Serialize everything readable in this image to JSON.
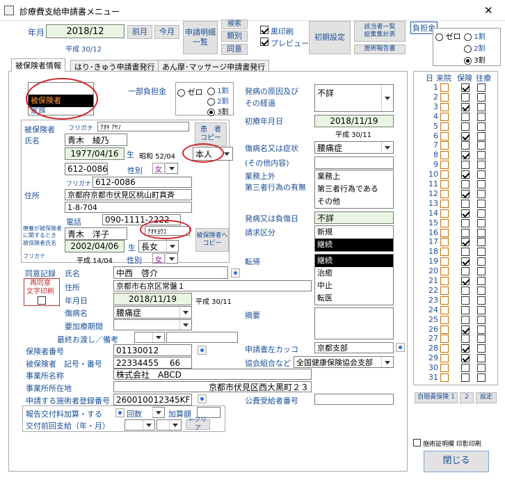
{
  "window": {
    "title": "診療費支給申請書メニュー",
    "close": "✕"
  },
  "header": {
    "year_month_label": "年月",
    "year_month": "2018/12",
    "heisei": "平成 30/12",
    "prev_month": "前月",
    "this_month": "今月",
    "print_detail": "申請明細\n一覧",
    "search": "検索",
    "category": "類別",
    "consent": "同意",
    "bw_print": "黒印刷",
    "preview": "プレビュー",
    "init_settings": "初期設定",
    "report1": "該当者一覧\n総集集計表",
    "report2": "施術報告書",
    "burden_link": "負担金"
  },
  "burden_top": {
    "options": [
      "ゼロ",
      "1割",
      "2割",
      "3割"
    ],
    "selected": "3割"
  },
  "tabs": [
    "被保険者情報",
    "はり･きゅう申請書発行",
    "あん摩･マッサージ申請書発行"
  ],
  "left": {
    "insured_types": [
      "被保険者",
      "家族"
    ],
    "insured_label": "被保険者",
    "name_label": "氏名",
    "furigana_label": "フリガナ",
    "furigana": "ｱｵｷ ｱﾔﾉ",
    "name": "青木　綾乃",
    "birth": "1977/04/16",
    "birth_suffix": "生",
    "showa": "昭和 52/04",
    "relation": "本人",
    "postal": "612-0086",
    "gender_label": "性別",
    "gender": "女",
    "furigana_postal_label": "フリガナ",
    "postal2": "612-0086",
    "address_label": "住所",
    "address1": "京都府京都市伏見区桃山町真斉",
    "address2": "1-8-704",
    "phone_label": "電話",
    "phone": "090-1111-2222",
    "copy_patient": "患　者\nコピー",
    "other_label": "療養が被保険者\nに関するとき\n被保険者氏名",
    "other_furigana_label": "フリガナ",
    "other_name": "青木　洋子",
    "other_furigana": "ｱｵｷﾖｳｺ",
    "copy_insured": "被保険者へ\nコピー",
    "other_birth": "2002/04/06",
    "other_birth_suffix": "生",
    "other_relation": "長女",
    "other_heisei": "平成 14/04",
    "other_gender_label": "性別",
    "other_gender": "女"
  },
  "burden": {
    "label": "一部負担金",
    "options": [
      "ゼロ",
      "1割",
      "2割",
      "3割"
    ],
    "selected": "3割"
  },
  "middle": {
    "cause_label": "発病の原因及び\nその経過",
    "cause": "不詳",
    "first_visit_label": "初療年月日",
    "first_visit": "2018/11/19",
    "first_visit_heisei": "平成 30/11",
    "disease_label": "傷病名又は症状",
    "disease": "腰痛症",
    "other_detail_label": "(その他内容)",
    "business_label": "業務上外\n第三者行為の有無",
    "business_list": [
      "業務上",
      "第三者行為である",
      "その他"
    ],
    "onset_label": "発病又は負傷日",
    "onset": "不詳",
    "claim_label": "請求区分",
    "claim_list": [
      "新規",
      "継続"
    ],
    "claim_selected": "継続",
    "outcome_label": "転帰",
    "outcome_list": [
      "継続",
      "治癒",
      "中止",
      "転医"
    ],
    "outcome_selected": "継続"
  },
  "consent": {
    "record_label": "同意記録",
    "reprint_label": "再同意\n文字印刷",
    "name_label": "氏名",
    "name": "中西　啓介",
    "address_label": "住所",
    "address": "京都市右京区常盤１",
    "date_label": "年月日",
    "date": "2018/11/19",
    "date_heisei": "平成 30/11",
    "disease_label": "傷病名",
    "disease": "腰痛症",
    "period_label": "要加療期間",
    "summary_label": "摘要",
    "last_label": "最終お渡し／備考"
  },
  "insurer": {
    "number_label": "保険者番号",
    "number": "01130012",
    "card_label": "被保険者　記号・番号",
    "card": "22334455　 66",
    "office_label": "事業所名称",
    "office": "株式会社　ABCD",
    "office_addr_label": "事業所所在地",
    "office_addr": "京都市伏見区西大黒町２３",
    "reg_label": "申請する施術者登録番号",
    "reg": "260010012345KF",
    "kakko_label": "申請書左カッコ",
    "kakko": "京都支部",
    "assoc_label": "協会組合など",
    "assoc": "全国健康保険協会支部",
    "public_label": "公費受給者番号"
  },
  "bottom": {
    "fee_label": "報告交付料加算・する",
    "count_label": "回数",
    "add_label": "加算額",
    "prev_label": "交付前回支給（年・月）",
    "clear": "←クリア"
  },
  "right": {
    "day_header": "日",
    "visit_header": "来院",
    "insured_header": "保険",
    "home_header": "往療",
    "days": [
      1,
      2,
      3,
      4,
      5,
      6,
      7,
      8,
      9,
      10,
      11,
      12,
      13,
      14,
      15,
      16,
      17,
      18,
      19,
      20,
      21,
      22,
      23,
      24,
      25,
      26,
      27,
      28,
      29,
      30,
      31
    ],
    "visits": [
      1,
      3,
      6,
      8,
      10,
      12,
      14,
      17,
      19,
      21,
      26,
      28,
      29
    ],
    "insured_btn1": "自賠責保険 1",
    "insured_btn2": "2",
    "settings_btn": "設定",
    "cert_label": "施術証明欄 印影印刷",
    "close": "閉じる"
  }
}
